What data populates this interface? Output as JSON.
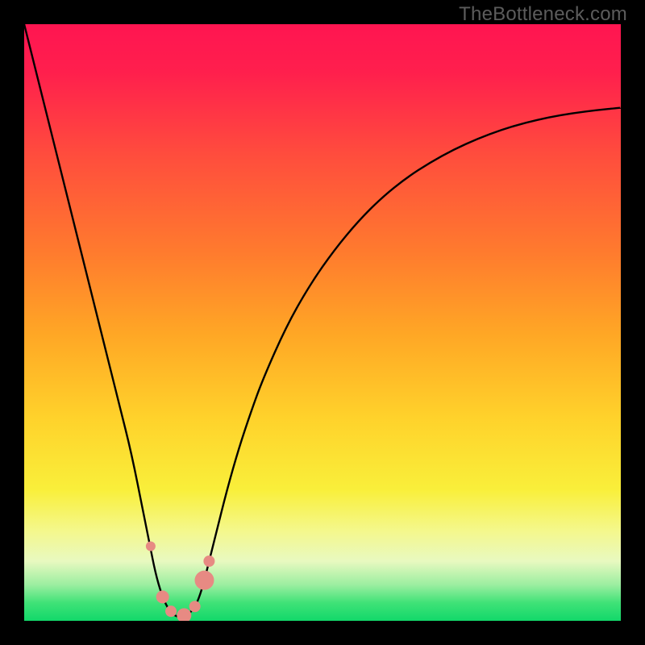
{
  "watermark": "TheBottleneck.com",
  "colors": {
    "marker": "#e78a83",
    "curve": "#000000",
    "frame": "#000000"
  },
  "chart_data": {
    "type": "line",
    "title": "",
    "xlabel": "",
    "ylabel": "",
    "xlim": [
      0,
      100
    ],
    "ylim": [
      0,
      100
    ],
    "x_optimal": 26,
    "series": [
      {
        "name": "bottleneck-curve",
        "x": [
          0,
          2,
          4,
          6,
          8,
          10,
          12,
          14,
          16,
          18,
          20,
          21,
          22,
          23,
          24,
          25,
          26,
          27,
          28,
          29,
          30,
          31,
          32,
          34,
          36,
          38,
          40,
          44,
          48,
          52,
          56,
          60,
          64,
          68,
          72,
          76,
          80,
          84,
          88,
          92,
          96,
          100
        ],
        "y": [
          100,
          92,
          84,
          76,
          68,
          60,
          52,
          44,
          36,
          28,
          18,
          13,
          8,
          4.5,
          2.2,
          1,
          0.6,
          0.8,
          1.5,
          3,
          6,
          10,
          14,
          22,
          29,
          35,
          40.5,
          49.5,
          56.5,
          62.2,
          67,
          71,
          74.2,
          76.8,
          79,
          80.8,
          82.3,
          83.5,
          84.4,
          85.1,
          85.6,
          86
        ]
      }
    ],
    "markers": [
      {
        "x": 21.2,
        "y": 12.5,
        "r": 6
      },
      {
        "x": 23.2,
        "y": 4.0,
        "r": 8
      },
      {
        "x": 24.6,
        "y": 1.6,
        "r": 7
      },
      {
        "x": 26.8,
        "y": 0.9,
        "r": 9
      },
      {
        "x": 28.6,
        "y": 2.4,
        "r": 7
      },
      {
        "x": 30.2,
        "y": 6.8,
        "r": 12
      },
      {
        "x": 31.0,
        "y": 10.0,
        "r": 7
      }
    ],
    "gradient_stops": [
      {
        "pct": 0,
        "color": "#ff1551"
      },
      {
        "pct": 22,
        "color": "#ff4d3d"
      },
      {
        "pct": 52,
        "color": "#ffa725"
      },
      {
        "pct": 78,
        "color": "#f9ef3a"
      },
      {
        "pct": 94,
        "color": "#9beea0"
      },
      {
        "pct": 100,
        "color": "#12d86a"
      }
    ]
  }
}
